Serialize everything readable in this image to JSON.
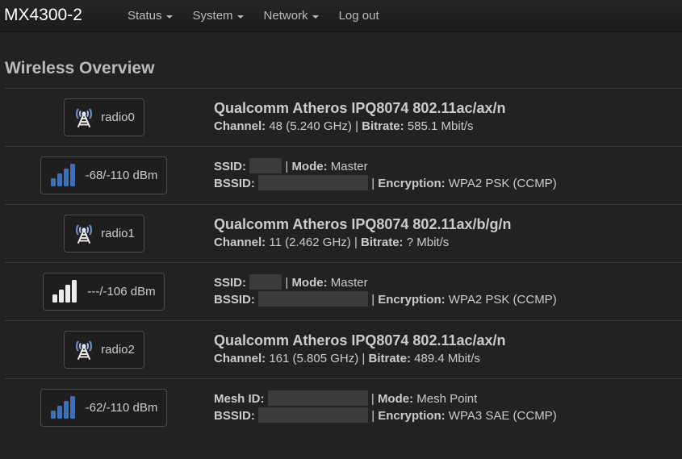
{
  "header": {
    "brand": "MX4300-2",
    "menu": [
      {
        "label": "Status",
        "dropdown": true
      },
      {
        "label": "System",
        "dropdown": true
      },
      {
        "label": "Network",
        "dropdown": true
      },
      {
        "label": "Log out",
        "dropdown": false
      }
    ]
  },
  "page_title": "Wireless Overview",
  "labels": {
    "channel": "Channel:",
    "bitrate": "Bitrate:",
    "ssid": "SSID:",
    "mode": "Mode:",
    "bssid": "BSSID:",
    "encryption": "Encryption:",
    "mesh_id": "Mesh ID:",
    "sep": "|"
  },
  "radios": [
    {
      "icon": "wifi-antenna-icon",
      "name": "radio0",
      "device": "Qualcomm Atheros IPQ8074 802.11ac/ax/n",
      "channel": "48 (5.240 GHz)",
      "bitrate": "585.1 Mbit/s",
      "network": {
        "signal_icon": "signal-bars-icon",
        "signal": "-68/-110 dBm",
        "signal_bars_active": 4,
        "id_label": "SSID:",
        "mode": "Master",
        "encryption": "WPA2 PSK (CCMP)"
      }
    },
    {
      "icon": "wifi-antenna-icon",
      "name": "radio1",
      "device": "Qualcomm Atheros IPQ8074 802.11ax/b/g/n",
      "channel": "11 (2.462 GHz)",
      "bitrate": "? Mbit/s",
      "network": {
        "signal_icon": "signal-bars-icon",
        "signal": "---/-106 dBm",
        "signal_bars_active": 0,
        "id_label": "SSID:",
        "mode": "Master",
        "encryption": "WPA2 PSK (CCMP)"
      }
    },
    {
      "icon": "wifi-antenna-icon",
      "name": "radio2",
      "device": "Qualcomm Atheros IPQ8074 802.11ac/ax/n",
      "channel": "161 (5.805 GHz)",
      "bitrate": "489.4 Mbit/s",
      "network": {
        "signal_icon": "signal-bars-icon",
        "signal": "-62/-110 dBm",
        "signal_bars_active": 4,
        "id_label": "Mesh ID:",
        "mode": "Mesh Point",
        "encryption": "WPA3 SAE (CCMP)"
      }
    }
  ],
  "colors": {
    "bar_active": "#3f6fb5",
    "bar_inactive": "#eeeeee",
    "background": "#222222"
  }
}
